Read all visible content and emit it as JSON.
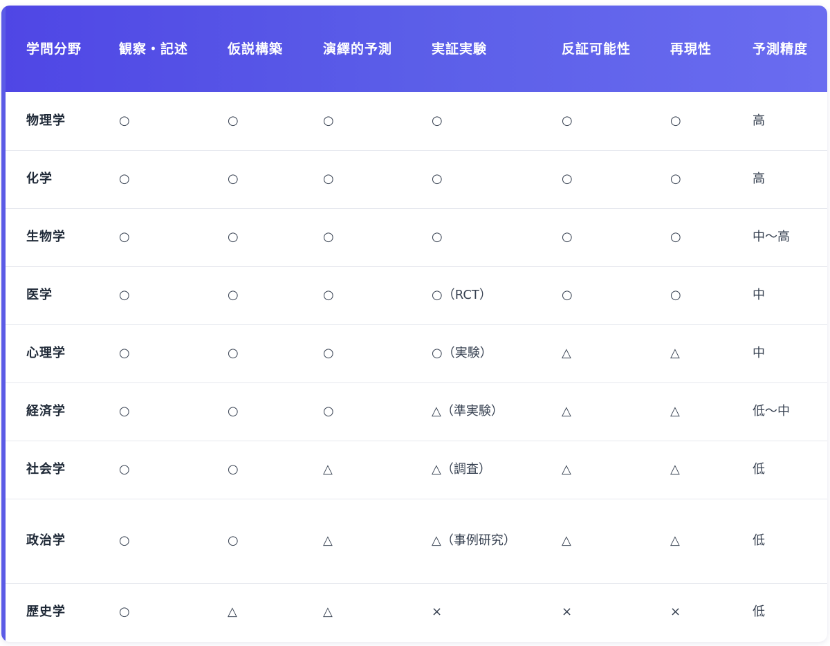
{
  "table": {
    "headers": [
      "学問分野",
      "観察・記述",
      "仮説構築",
      "演繹的予測",
      "実証実験",
      "反証可能性",
      "再現性",
      "予測精度"
    ],
    "rows": [
      [
        "物理学",
        "○",
        "○",
        "○",
        "○",
        "○",
        "○",
        "高"
      ],
      [
        "化学",
        "○",
        "○",
        "○",
        "○",
        "○",
        "○",
        "高"
      ],
      [
        "生物学",
        "○",
        "○",
        "○",
        "○",
        "○",
        "○",
        "中～高"
      ],
      [
        "医学",
        "○",
        "○",
        "○",
        "○（RCT）",
        "○",
        "○",
        "中"
      ],
      [
        "心理学",
        "○",
        "○",
        "○",
        "○（実験）",
        "△",
        "△",
        "中"
      ],
      [
        "経済学",
        "○",
        "○",
        "○",
        "△（準実験）",
        "△",
        "△",
        "低～中"
      ],
      [
        "社会学",
        "○",
        "○",
        "△",
        "△（調査）",
        "△",
        "△",
        "低"
      ],
      [
        "政治学",
        "○",
        "○",
        "△",
        "△（事例研究）",
        "△",
        "△",
        "低"
      ],
      [
        "歴史学",
        "○",
        "△",
        "△",
        "×",
        "×",
        "×",
        "低"
      ]
    ]
  },
  "colors": {
    "header_start": "#4f46e5",
    "header_end": "#6a6cf0",
    "accent": "#5b5be6",
    "text": "#374151",
    "divider": "#e6e8ee"
  }
}
